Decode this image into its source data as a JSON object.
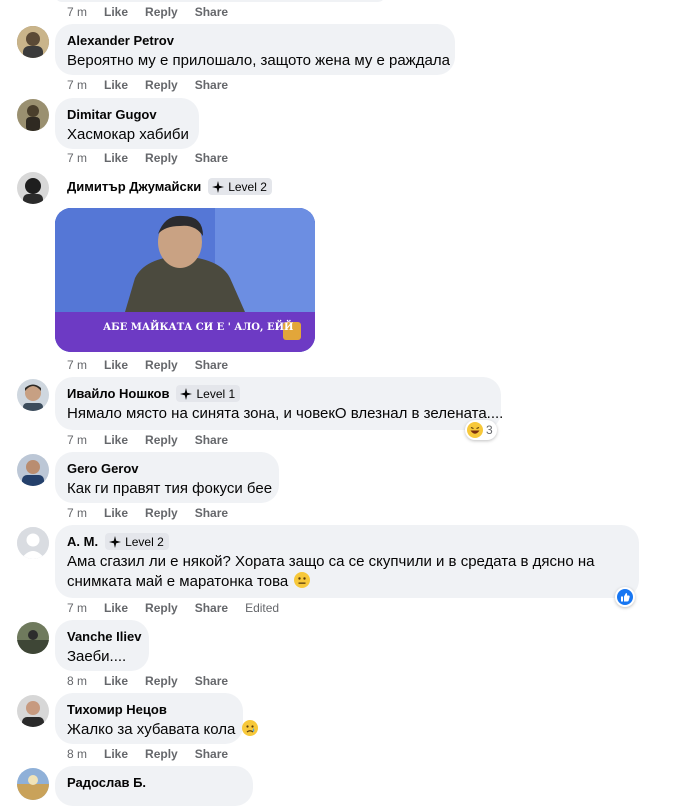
{
  "top_actions": {
    "time": "7 m",
    "like": "Like",
    "reply": "Reply",
    "share": "Share"
  },
  "comments": [
    {
      "name": "Alexander Petrov",
      "text": "Вероятно му е прилошало, защото жена му е раждала",
      "time": "7 m"
    },
    {
      "name": "Dimitar Gugov",
      "text": "Хасмокар хабиби",
      "time": "7 m"
    },
    {
      "name": "Димитър Джумайски",
      "badge": "Level 2",
      "gif_caption": "АБЕ МАЙКАТА СИ  Е ' АЛО, ЕЙЙ",
      "time": "7 m"
    },
    {
      "name": "Ивайло Ношков",
      "badge": "Level 1",
      "text": "Нямало място на синята зона, и човекО влезнал в зелената....",
      "reaction_count": "3",
      "time": "7 m"
    },
    {
      "name": "Gero Gerov",
      "text": "Как ги правят тия фокуси бее",
      "time": "7 m"
    },
    {
      "name": "A. M.",
      "badge": "Level 2",
      "text_line1": "Ама сгазил ли е някой? Хората защо са се скупчили и в средата в дясно на",
      "text_line2": "снимката май е маратонка това",
      "time": "7 m",
      "edited": "Edited"
    },
    {
      "name": "Vanche Iliev",
      "text": "Заеби....",
      "time": "8 m"
    },
    {
      "name": "Тихомир Нецов",
      "text": "Жалко за хубавата кола",
      "time": "8 m"
    },
    {
      "name": "Радослав Б."
    }
  ],
  "labels": {
    "like": "Like",
    "reply": "Reply",
    "share": "Share"
  },
  "colors": {
    "bubble": "#f0f2f5",
    "meta": "#65676b",
    "like_blue": "#1877f2",
    "gif_bg": "#3a57c4"
  },
  "icons": {
    "badge": "sparkle-badge-icon",
    "react_laugh": "laugh-emoji-icon",
    "react_like": "like-thumb-icon",
    "neutral": "neutral-face-emoji",
    "cry": "crying-face-emoji"
  }
}
